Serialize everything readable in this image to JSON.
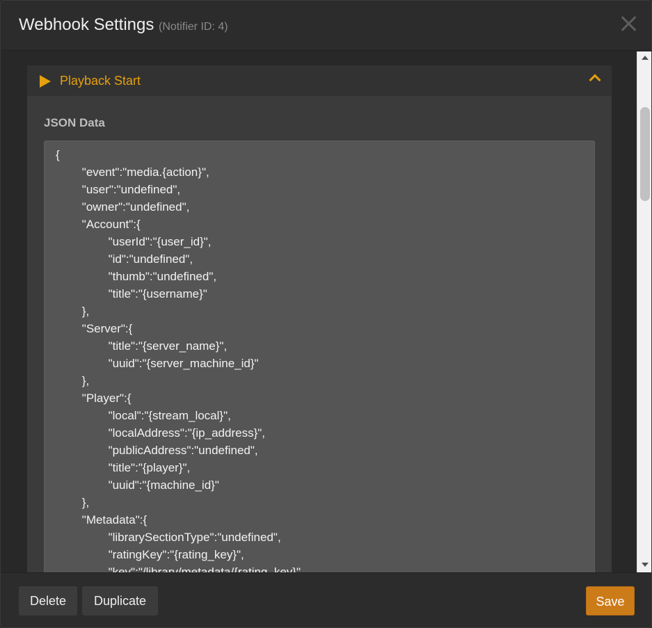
{
  "header": {
    "title": "Webhook Settings",
    "subtitle": "(Notifier ID: 4)"
  },
  "panel": {
    "title": "Playback Start"
  },
  "json_label": "JSON Data",
  "json_lines": [
    "{",
    "        \"event\":\"media.{action}\",",
    "        \"user\":\"undefined\",",
    "        \"owner\":\"undefined\",",
    "        \"Account\":{",
    "                \"userId\":\"{user_id}\",",
    "                \"id\":\"undefined\",",
    "                \"thumb\":\"undefined\",",
    "                \"title\":\"{username}\"",
    "        },",
    "        \"Server\":{",
    "                \"title\":\"{server_name}\",",
    "                \"uuid\":\"{server_machine_id}\"",
    "        },",
    "        \"Player\":{",
    "                \"local\":\"{stream_local}\",",
    "                \"localAddress\":\"{ip_address}\",",
    "                \"publicAddress\":\"undefined\",",
    "                \"title\":\"{player}\",",
    "                \"uuid\":\"{machine_id}\"",
    "        },",
    "        \"Metadata\":{",
    "                \"librarySectionType\":\"undefined\",",
    "                \"ratingKey\":\"{rating_key}\",",
    "                \"key\":\"/library/metadata/{rating_key}\","
  ],
  "footer": {
    "delete_label": "Delete",
    "duplicate_label": "Duplicate",
    "save_label": "Save"
  },
  "colors": {
    "accent": "#e5a00d",
    "save_button": "#cc7b19"
  },
  "icons": {
    "close": "close-icon",
    "play": "play-icon",
    "collapse": "chevron-up-icon"
  }
}
